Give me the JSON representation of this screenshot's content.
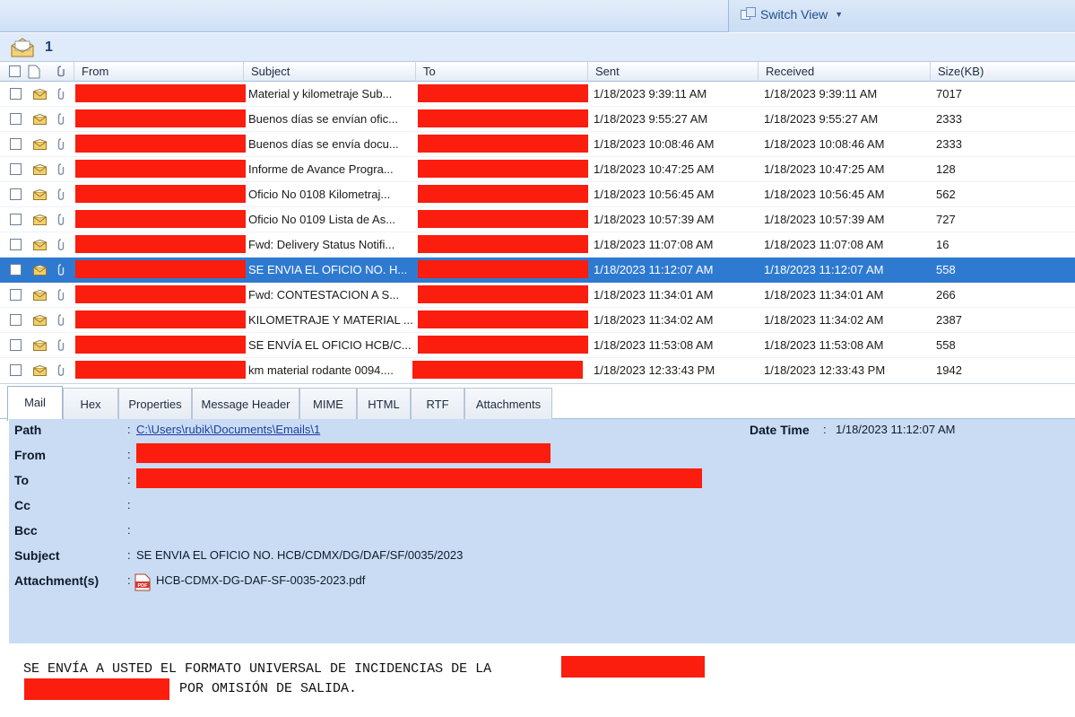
{
  "toolbar": {
    "switch_view_label": "Switch View"
  },
  "folder": {
    "count": "1"
  },
  "columns": {
    "from": "From",
    "subject": "Subject",
    "to": "To",
    "sent": "Sent",
    "received": "Received",
    "size": "Size(KB)"
  },
  "emails": [
    {
      "subject": "Material y kilometraje Sub...",
      "sent": "1/18/2023 9:39:11 AM",
      "received": "1/18/2023 9:39:11 AM",
      "size": "7017"
    },
    {
      "subject": "Buenos días se envían ofic...",
      "sent": "1/18/2023 9:55:27 AM",
      "received": "1/18/2023 9:55:27 AM",
      "size": "2333"
    },
    {
      "subject": "Buenos días se envía docu...",
      "sent": "1/18/2023 10:08:46 AM",
      "received": "1/18/2023 10:08:46 AM",
      "size": "2333"
    },
    {
      "subject": "Informe de Avance Progra...",
      "sent": "1/18/2023 10:47:25 AM",
      "received": "1/18/2023 10:47:25 AM",
      "size": "128"
    },
    {
      "subject": "Oficio No 0108 Kilometraj...",
      "sent": "1/18/2023 10:56:45 AM",
      "received": "1/18/2023 10:56:45 AM",
      "size": "562"
    },
    {
      "subject": "Oficio No 0109 Lista de As...",
      "sent": "1/18/2023 10:57:39 AM",
      "received": "1/18/2023 10:57:39 AM",
      "size": "727"
    },
    {
      "subject": "Fwd: Delivery Status Notifi...",
      "sent": "1/18/2023 11:07:08 AM",
      "received": "1/18/2023 11:07:08 AM",
      "size": "16"
    },
    {
      "subject": "SE ENVIA EL OFICIO NO. H...",
      "sent": "1/18/2023 11:12:07 AM",
      "received": "1/18/2023 11:12:07 AM",
      "size": "558"
    },
    {
      "subject": "Fwd: CONTESTACION A S...",
      "sent": "1/18/2023 11:34:01 AM",
      "received": "1/18/2023 11:34:01 AM",
      "size": "266"
    },
    {
      "subject": "KILOMETRAJE Y MATERIAL ...",
      "sent": "1/18/2023 11:34:02 AM",
      "received": "1/18/2023 11:34:02 AM",
      "size": "2387"
    },
    {
      "subject": "SE ENVÍA EL OFICIO HCB/C...",
      "sent": "1/18/2023 11:53:08 AM",
      "received": "1/18/2023 11:53:08 AM",
      "size": "558"
    },
    {
      "subject": "km material rodante 0094....",
      "sent": "1/18/2023 12:33:43 PM",
      "received": "1/18/2023 12:33:43 PM",
      "size": "1942"
    }
  ],
  "tabs": [
    "Mail",
    "Hex",
    "Properties",
    "Message Header",
    "MIME",
    "HTML",
    "RTF",
    "Attachments"
  ],
  "details": {
    "path_label": "Path",
    "path_value": "C:\\Users\\rubik\\Documents\\Emails\\1",
    "datetime_label": "Date Time",
    "datetime_value": "1/18/2023 11:12:07 AM",
    "from_label": "From",
    "to_label": "To",
    "cc_label": "Cc",
    "bcc_label": "Bcc",
    "subject_label": "Subject",
    "subject_value": "SE ENVIA EL OFICIO NO. HCB/CDMX/DG/DAF/SF/0035/2023",
    "attachments_label": "Attachment(s)",
    "attachment_name": "HCB-CDMX-DG-DAF-SF-0035-2023.pdf"
  },
  "body": {
    "line1": "SE ENVÍA A USTED EL FORMATO UNIVERSAL DE INCIDENCIAS DE LA",
    "line2": "POR OMISIÓN DE SALIDA."
  },
  "colors": {
    "selection": "#2f7ad1",
    "redaction": "#fb1d0d",
    "details_bg": "#c9dcf4"
  }
}
